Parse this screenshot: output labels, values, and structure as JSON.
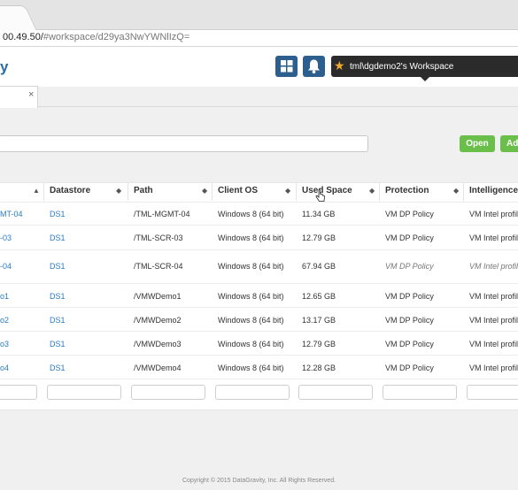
{
  "browser": {
    "address": "00.49.50/",
    "address_hash": "#workspace/d29ya3NwYWNlIzQ="
  },
  "header": {
    "logo_fragment": "y",
    "workspace_label": "tml\\dgdemo2's Workspace",
    "icons": [
      "grid-icon",
      "bell-icon",
      "star-icon"
    ],
    "accent_color": "#2d5f8e",
    "workspace_bar_color": "#2b2b2b",
    "star_color": "#f0a92e"
  },
  "tab": {
    "close_glyph": "×"
  },
  "toolbar": {
    "open_label": "Open",
    "add_label_fragment": "Ad",
    "button_color": "#6abf4b"
  },
  "table": {
    "columns": [
      "Datastore",
      "Path",
      "Client OS",
      "Used Space",
      "Protection",
      "Intelligence"
    ],
    "rows": [
      {
        "name": "MT-04",
        "datastore": "DS1",
        "path": "/TML-MGMT-04",
        "os": "Windows 8 (64 bit)",
        "used": "11.34 GB",
        "protection": "VM DP Policy",
        "intelligence": "VM Intel profile"
      },
      {
        "name": "-03",
        "datastore": "DS1",
        "path": "/TML-SCR-03",
        "os": "Windows 8 (64 bit)",
        "used": "12.79 GB",
        "protection": "VM DP Policy",
        "intelligence": "VM Intel profile"
      },
      {
        "name": "-04",
        "datastore": "DS1",
        "path": "/TML-SCR-04",
        "os": "Windows 8 (64 bit)",
        "used": "67.94 GB",
        "protection": "VM DP Policy",
        "intelligence": "VM Intel profile"
      },
      {
        "name": "o1",
        "datastore": "DS1",
        "path": "/VMWDemo1",
        "os": "Windows 8 (64 bit)",
        "used": "12.65 GB",
        "protection": "VM DP Policy",
        "intelligence": "VM Intel profile"
      },
      {
        "name": "o2",
        "datastore": "DS1",
        "path": "/VMWDemo2",
        "os": "Windows 8 (64 bit)",
        "used": "13.17 GB",
        "protection": "VM DP Policy",
        "intelligence": "VM Intel profile"
      },
      {
        "name": "o3",
        "datastore": "DS1",
        "path": "/VMWDemo3",
        "os": "Windows 8 (64 bit)",
        "used": "12.79 GB",
        "protection": "VM DP Policy",
        "intelligence": "VM Intel profile"
      },
      {
        "name": "o4",
        "datastore": "DS1",
        "path": "/VMWDemo4",
        "os": "Windows 8 (64 bit)",
        "used": "12.28 GB",
        "protection": "VM DP Policy",
        "intelligence": "VM Intel profile"
      }
    ],
    "link_color": "#2a7bc2"
  },
  "footer": {
    "text": "Copyright © 2015 DataGravity, Inc. All Rights Reserved."
  }
}
